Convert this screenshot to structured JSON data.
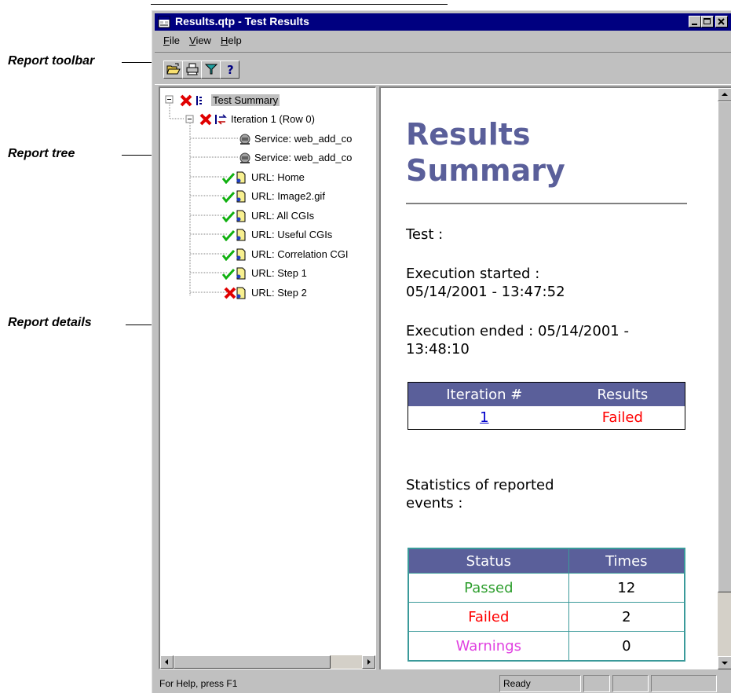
{
  "callouts": {
    "toolbar": "Report toolbar",
    "tree": "Report tree",
    "details": "Report details"
  },
  "window": {
    "title": "Results.qtp - Test Results"
  },
  "menu": [
    "File",
    "View",
    "Help"
  ],
  "toolbar": {
    "buttons": [
      "open-icon",
      "print-icon",
      "filter-icon",
      "help-icon"
    ]
  },
  "tree": {
    "root": "Test Summary",
    "iteration": "Iteration 1 (Row 0)",
    "items": [
      {
        "label": "Service: web_add_co",
        "status": "none"
      },
      {
        "label": "Service: web_add_co",
        "status": "none"
      },
      {
        "label": "URL: Home",
        "status": "passed"
      },
      {
        "label": "URL: Image2.gif",
        "status": "passed"
      },
      {
        "label": "URL: All CGIs",
        "status": "passed"
      },
      {
        "label": "URL: Useful CGIs",
        "status": "passed"
      },
      {
        "label": "URL: Correlation CGI",
        "status": "passed"
      },
      {
        "label": "URL: Step 1",
        "status": "passed"
      },
      {
        "label": "URL: Step 2",
        "status": "failed"
      }
    ]
  },
  "details": {
    "title_line1": "Results",
    "title_line2": "Summary",
    "test_label": "Test :",
    "started_label": "Execution started :",
    "started_value": "05/14/2001 - 13:47:52",
    "ended_label": "Execution ended :",
    "ended_value": "05/14/2001 - 13:48:10",
    "iteration_table": {
      "headers": [
        "Iteration #",
        "Results"
      ],
      "row": {
        "iteration": "1",
        "result": "Failed"
      }
    },
    "stats_label_line1": "Statistics of reported",
    "stats_label_line2": "events :",
    "stats_table": {
      "headers": [
        "Status",
        "Times"
      ],
      "rows": [
        {
          "status": "Passed",
          "times": "12"
        },
        {
          "status": "Failed",
          "times": "2"
        },
        {
          "status": "Warnings",
          "times": "0"
        }
      ]
    }
  },
  "statusbar": {
    "help": "For Help, press F1",
    "state": "Ready"
  },
  "colors": {
    "titlebar": "#000080",
    "heading": "#5a5f9a",
    "passed": "#2e9e2e",
    "failed": "#ff0000",
    "warnings": "#e040e0",
    "link": "#0000cc"
  }
}
